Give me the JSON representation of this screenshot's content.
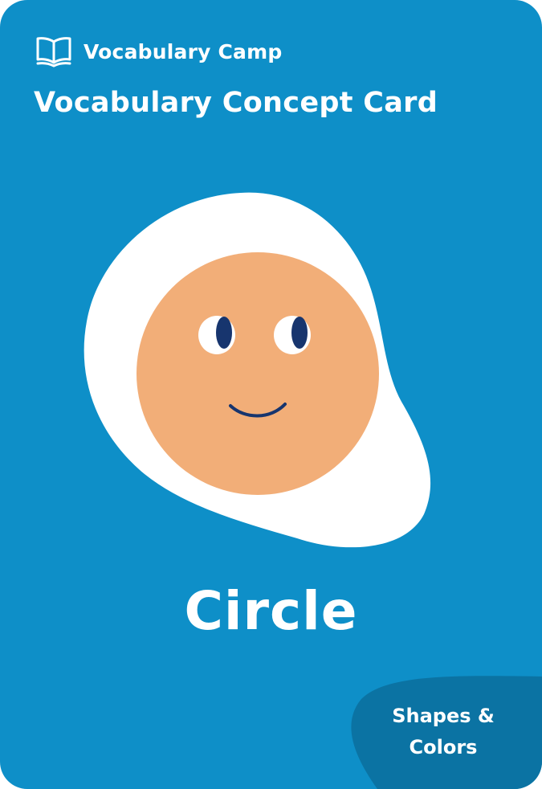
{
  "brand": {
    "name": "Vocabulary Camp",
    "icon": "open-book-icon"
  },
  "card": {
    "title": "Vocabulary Concept Card",
    "word": "Circle",
    "category_line1": "Shapes &",
    "category_line2": "Colors"
  },
  "colors": {
    "background": "#0e8fc8",
    "category_badge": "#0b73a3",
    "blob": "#ffffff",
    "circle_face": "#f2ae78",
    "eye_pupil": "#17356e",
    "text": "#ffffff"
  }
}
